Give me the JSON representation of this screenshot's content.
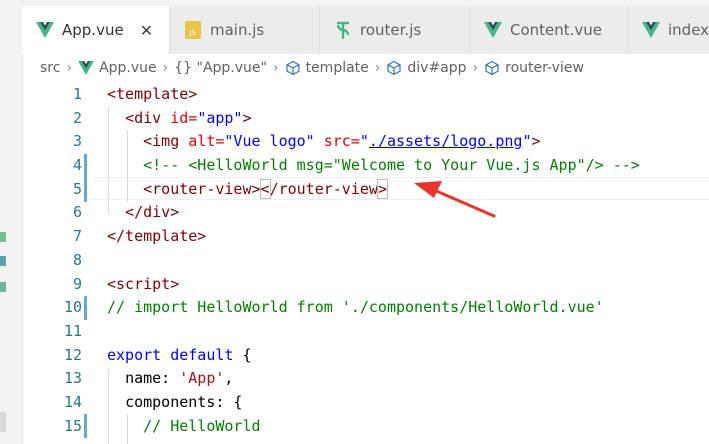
{
  "tabs": [
    {
      "label": "App.vue",
      "icon": "vue-icon",
      "active": true,
      "close": "✕"
    },
    {
      "label": "main.js",
      "icon": "js-file-icon",
      "active": false
    },
    {
      "label": "router.js",
      "icon": "router-file-icon",
      "active": false
    },
    {
      "label": "Content.vue",
      "icon": "vue-icon",
      "active": false
    },
    {
      "label": "index",
      "icon": "vue-icon",
      "active": false
    }
  ],
  "breadcrumb": {
    "src": "src",
    "file": "App.vue",
    "component": "{} \"App.vue\"",
    "template": "template",
    "div": "div#app",
    "router": "router-view"
  },
  "colors": {
    "vue": "#41b883",
    "js_badge": "#e8c44a",
    "modified": "#68a8d6",
    "arrow": "#e8352a",
    "line_number": "#237893"
  },
  "line_numbers": [
    "1",
    "2",
    "3",
    "4",
    "5",
    "6",
    "7",
    "8",
    "9",
    "10",
    "11",
    "12",
    "13",
    "14",
    "15"
  ],
  "code": {
    "l1_open": "<template>",
    "l2_open": "<div",
    "l2_attr": "id=",
    "l2_val": "\"app\"",
    "l2_close": ">",
    "l3_open": "<img",
    "l3_attr1": "alt=",
    "l3_val1": "\"Vue logo\"",
    "l3_attr2": "src=",
    "l3_q1": "\"",
    "l3_url": "./assets/logo.png",
    "l3_q2": "\"",
    "l3_close": ">",
    "l4_comment": "<!-- <HelloWorld msg=\"Welcome to Your Vue.js App\"/> -->",
    "l5_open": "<router-view>",
    "l5_lt": "<",
    "l5_closetag": "/router-view",
    "l5_gt": ">",
    "l6": "</div>",
    "l7": "</template>",
    "l9": "<script>",
    "l10_comment": "// import HelloWorld from './components/HelloWorld.vue'",
    "l12_export": "export",
    "l12_default": "default",
    "l12_brace": "{",
    "l13_key": "name:",
    "l13_val": "'App'",
    "l13_comma": ",",
    "l14": "components: {",
    "l15_comment": "// HelloWorld"
  }
}
